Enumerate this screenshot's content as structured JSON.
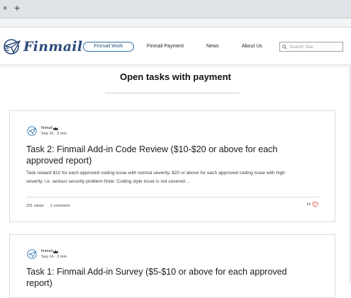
{
  "browser": {
    "tab_close": "×",
    "new_tab": "+"
  },
  "header": {
    "brand": "Finmail",
    "nav": [
      "Finmail Work",
      "Finmail Payment",
      "News",
      "About Us"
    ],
    "active_nav": "Finmail Work",
    "search_placeholder": "Search Site",
    "brand_color": "#2b4a7c",
    "accent_color": "#2b6fa8"
  },
  "page": {
    "title": "Open tasks with payment"
  },
  "posts": [
    {
      "author": "finmail",
      "date": "Sep 15",
      "read_time": "2 min",
      "title": "Task 2: Finmail Add-in Code Review ($10-$20 or above for each approved report)",
      "excerpt": "Task reward $10 for each approved coding issue with normal severity. $20 or above for each approved coding issue with high severity, i.e. serious security problem Note: Coding style issue is not covered…",
      "views": "231 views",
      "comments": "1 comment",
      "likes": "14"
    },
    {
      "author": "finmail",
      "date": "Sep 14",
      "read_time": "2 min",
      "title": "Task 1: Finmail Add-in Survey ($5-$10 or above for each approved report)"
    }
  ],
  "icons": {
    "logo": "paper-plane-logo",
    "search": "search-icon",
    "heart": "heart-icon",
    "crown": "crown-icon"
  }
}
